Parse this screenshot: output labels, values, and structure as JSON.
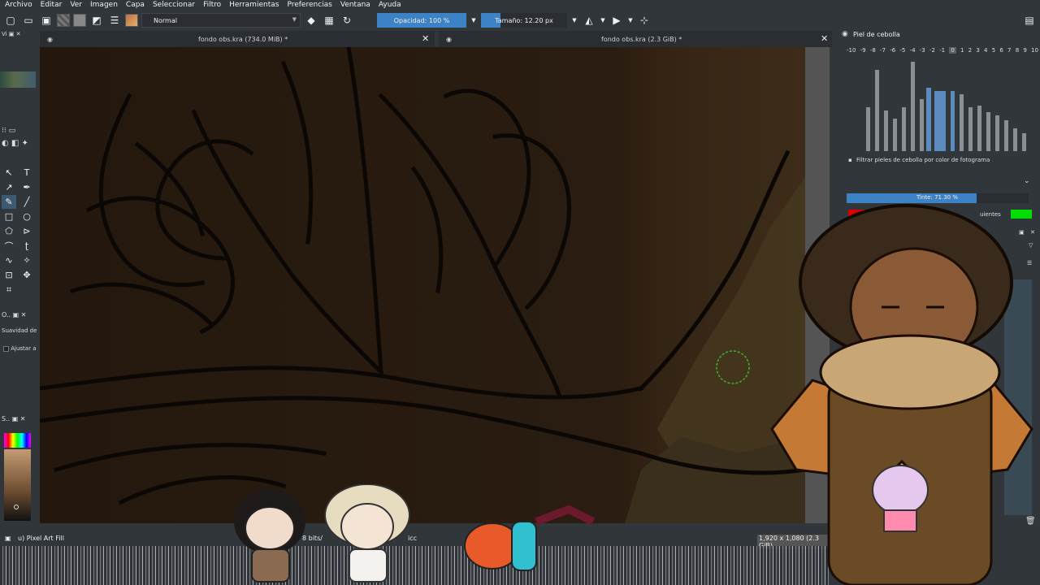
{
  "menu": [
    "Archivo",
    "Editar",
    "Ver",
    "Imagen",
    "Capa",
    "Seleccionar",
    "Filtro",
    "Herramientas",
    "Preferencias",
    "Ventana",
    "Ayuda"
  ],
  "toolbar": {
    "blend_mode": "Normal",
    "opacity_label": "Opacidad: 100 %",
    "size_label": "Tamaño: 12.20 px"
  },
  "tabs": [
    {
      "title": "fondo obs.kra (734.0 MiB) *"
    },
    {
      "title": "fondo obs.kra (2.3 GiB) *"
    }
  ],
  "left_panel": {
    "smoothing_label": "Suavidad de",
    "adjust_label": "Ajustar a"
  },
  "status_bar": {
    "brush_preset": "u) Pixel Art Fill",
    "color_info": "8 bits/",
    "profile": "icc",
    "dimensions": "1,920 x 1,080 (2.3 GiB)"
  },
  "onion_skin": {
    "title": "Piel de cebolla",
    "frame_numbers": [
      "-10",
      "-9",
      "-8",
      "-7",
      "-6",
      "-5",
      "-4",
      "-3",
      "-2",
      "-1",
      "0",
      "1",
      "2",
      "3",
      "4",
      "5",
      "6",
      "7",
      "8",
      "9",
      "10"
    ],
    "selected_frame": "0",
    "filter_label": "Filtrar pieles de cebolla por color de fotograma",
    "tint_label": "Tinte: 71.30 %",
    "tint_value": 71.3,
    "previous_label": "Fot",
    "next_label": "uientes",
    "previous_color": "#e00000",
    "next_color": "#00e000"
  },
  "colors": {
    "accent": "#3d82c4",
    "panel_bg": "#31363b",
    "canvas_bg": "#1f140c"
  }
}
